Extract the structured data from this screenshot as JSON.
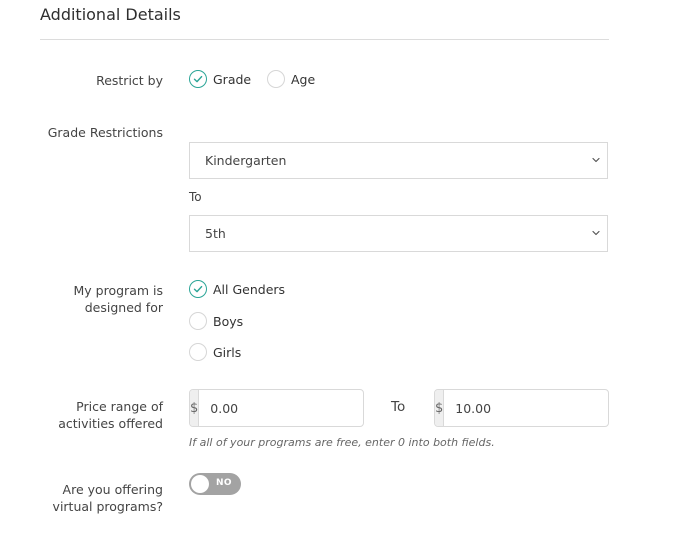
{
  "section": {
    "title": "Additional Details"
  },
  "restrict_by": {
    "label": "Restrict by",
    "options": [
      {
        "label": "Grade",
        "checked": true
      },
      {
        "label": "Age",
        "checked": false
      }
    ]
  },
  "grade_restrictions": {
    "label": "Grade Restrictions",
    "from_value": "Kindergarten",
    "to_label": "To",
    "to_value": "5th"
  },
  "designed_for": {
    "label_line1": "My program is",
    "label_line2": "designed for",
    "options": [
      {
        "label": "All Genders",
        "checked": true
      },
      {
        "label": "Boys",
        "checked": false
      },
      {
        "label": "Girls",
        "checked": false
      }
    ]
  },
  "price_range": {
    "label_line1": "Price range of",
    "label_line2": "activities offered",
    "currency": "$",
    "min_value": "0.00",
    "to_label": "To",
    "max_value": "10.00",
    "hint": "If all of your programs are free, enter 0 into both fields."
  },
  "virtual": {
    "label_line1": "Are you offering",
    "label_line2": "virtual programs?",
    "toggle_text": "NO",
    "enabled": false
  },
  "colors": {
    "accent": "#2ba597",
    "toggle_off": "#a3a3a3",
    "border": "#d9d9d9"
  },
  "icons": [
    "check-icon",
    "chevron-down-icon"
  ]
}
